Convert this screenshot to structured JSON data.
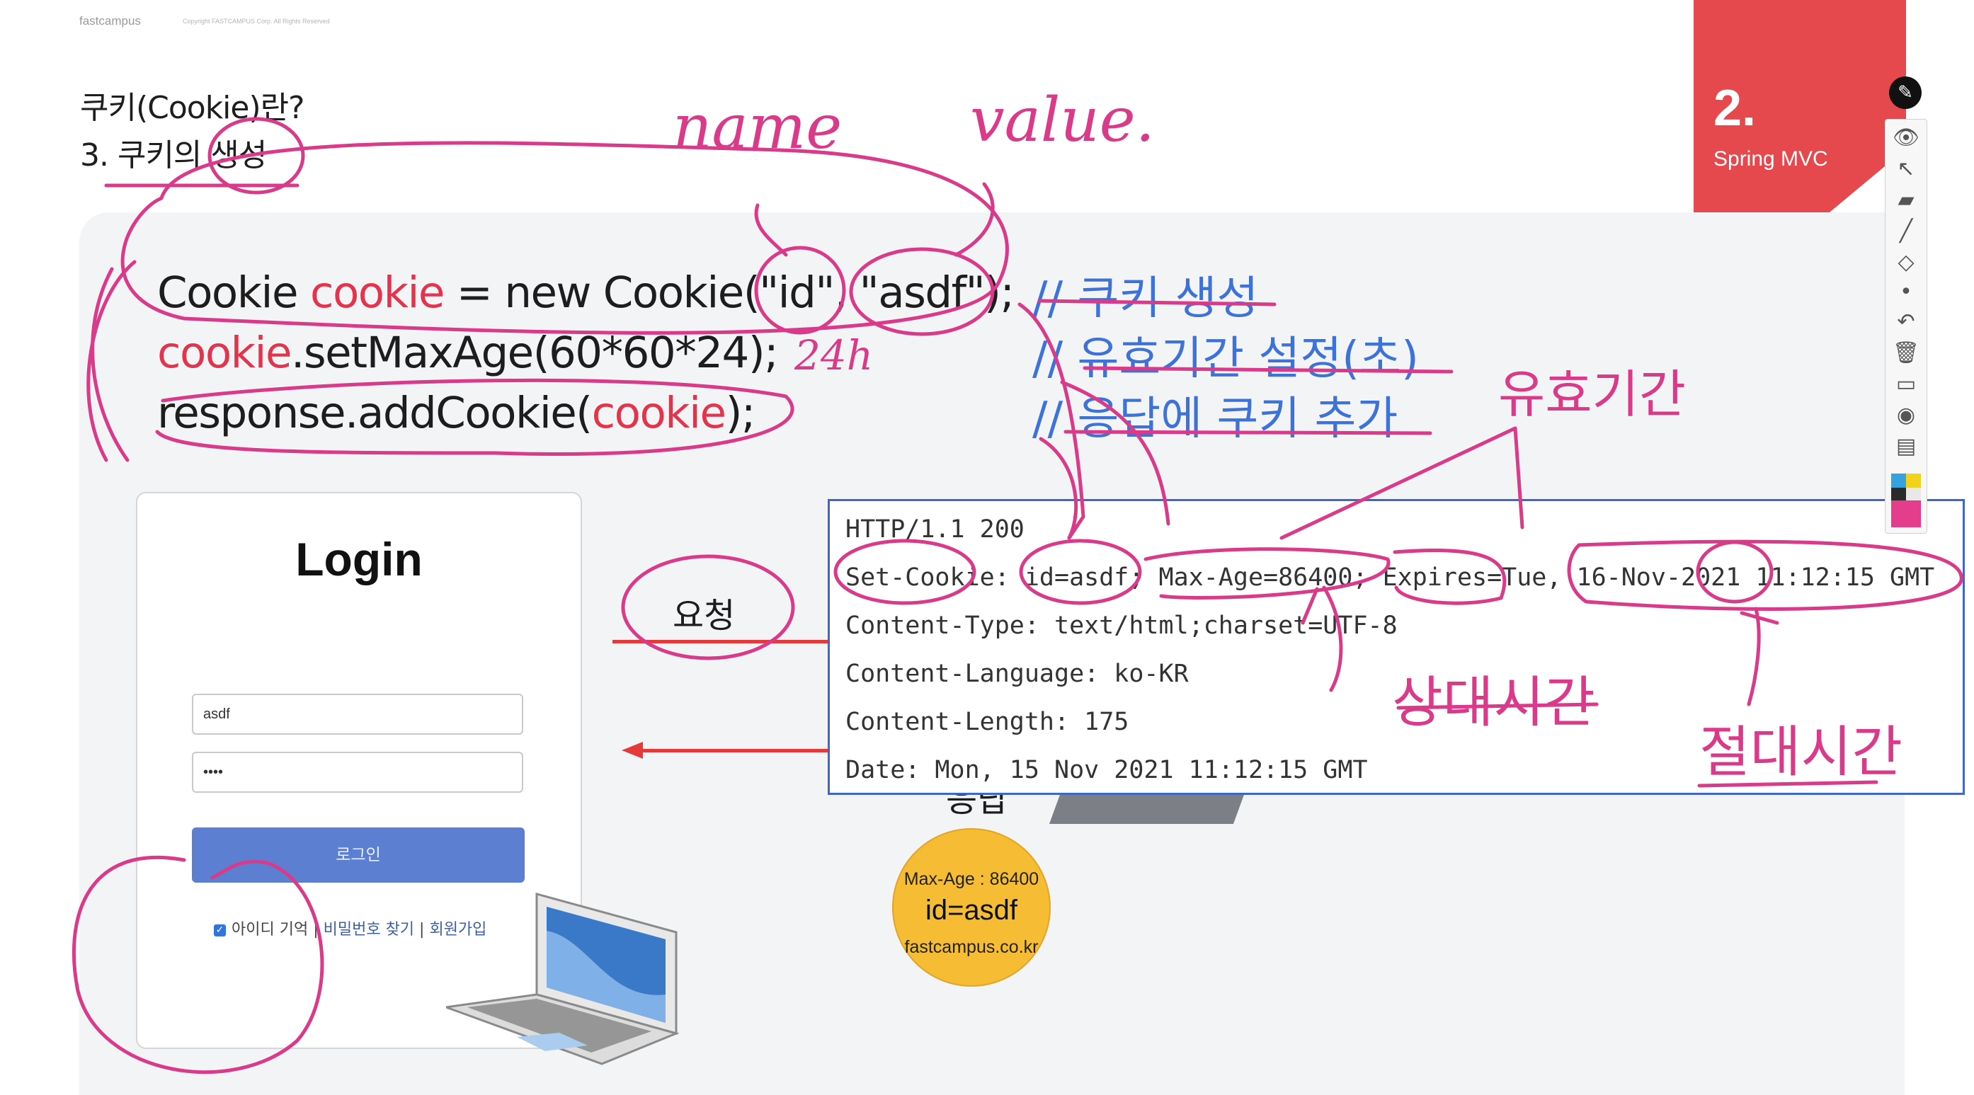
{
  "header": {
    "brand": "fastcampus",
    "copyright": "Copyright FASTCAMPUS Corp. All Rights Reserved"
  },
  "slide": {
    "breadcrumb_1": "쿠키(Cookie)란?",
    "breadcrumb_2": "3. 쿠키의 생성",
    "section_number": "2.",
    "section_title": "Spring MVC",
    "accent_color": "#e5484d"
  },
  "code": {
    "line1_a": "Cookie ",
    "line1_b": "cookie",
    "line1_c": " = new Cookie(\"id\", \"asdf\");",
    "line2_a": "cookie",
    "line2_b": ".setMaxAge(60*60*24);",
    "line3_a": "response.addCookie(",
    "line3_b": "cookie",
    "line3_c": ");",
    "comment1": "// 쿠키 생성",
    "comment2": "// 유효기간 설정(초)",
    "comment3": "// 응답에 쿠키 추가"
  },
  "login_form": {
    "title": "Login",
    "id_value": "asdf",
    "password_mask": "••••",
    "submit_label": "로그인",
    "remember_label": "아이디 기억",
    "separator": " | ",
    "find_password": "비밀번호 찾기",
    "signup": "회원가입"
  },
  "http_response": {
    "lines": [
      "HTTP/1.1 200",
      "Set-Cookie: id=asdf; Max-Age=86400; Expires=Tue, 16-Nov-2021 11:12:15 GMT",
      "Content-Type: text/html;charset=UTF-8",
      "Content-Language: ko-KR",
      "Content-Length: 175",
      "Date: Mon, 15 Nov 2021 11:12:15 GMT"
    ]
  },
  "flow": {
    "request_label": "요청",
    "response_label": "응답"
  },
  "cookie_badge": {
    "max_age": "Max-Age : 86400",
    "value": "id=asdf",
    "domain": "fastcampus.co.kr",
    "color": "#f6bc33"
  },
  "annotations": {
    "name": "name",
    "value": "value.",
    "hours": "24h",
    "validity": "유효기간",
    "relative_time": "상대시간",
    "absolute_time": "절대시간"
  },
  "toolbar": {
    "icons": [
      "pen-icon",
      "eye-icon",
      "pointer-icon",
      "highlighter-icon",
      "line-icon",
      "eraser-icon",
      "dot-icon",
      "undo-icon",
      "trash-icon",
      "whiteboard-icon",
      "camera-icon",
      "clipboard-icon",
      "color-swatch-icon"
    ]
  }
}
